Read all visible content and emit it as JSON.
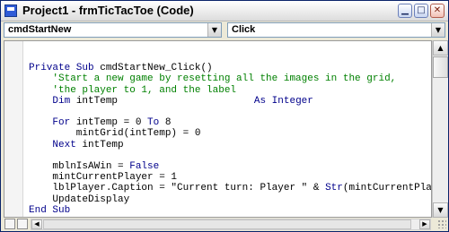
{
  "window": {
    "title": "Project1 - frmTicTacToe (Code)",
    "controls": [
      "minimize",
      "maximize",
      "close"
    ]
  },
  "object_combo": {
    "value": "cmdStartNew"
  },
  "procedure_combo": {
    "value": "Click"
  },
  "code_lines": [
    "Private Sub cmdStartNew_Click()",
    "    'Start a new game by resetting all the images in the grid,",
    "    'the player to 1, and the label",
    "    Dim intTemp                       As Integer",
    "",
    "    For intTemp = 0 To 8",
    "        mintGrid(intTemp) = 0",
    "    Next intTemp",
    "",
    "    mblnIsAWin = False",
    "    mintCurrentPlayer = 1",
    "    lblPlayer.Caption = \"Current turn: Player \" & Str(mintCurrentPlayer)",
    "    UpdateDisplay",
    "End Sub"
  ],
  "icons": {
    "app": "vb-project-icon",
    "minimize": "minimize-icon",
    "maximize": "maximize-icon",
    "close": "close-icon",
    "dropdown": "chevron-down-icon",
    "procedure_view": "procedure-view-icon",
    "full_module_view": "full-module-view-icon"
  },
  "colors": {
    "keyword": "#00008b",
    "comment": "#008000",
    "text": "#000000",
    "title_border": "#0a246a"
  }
}
